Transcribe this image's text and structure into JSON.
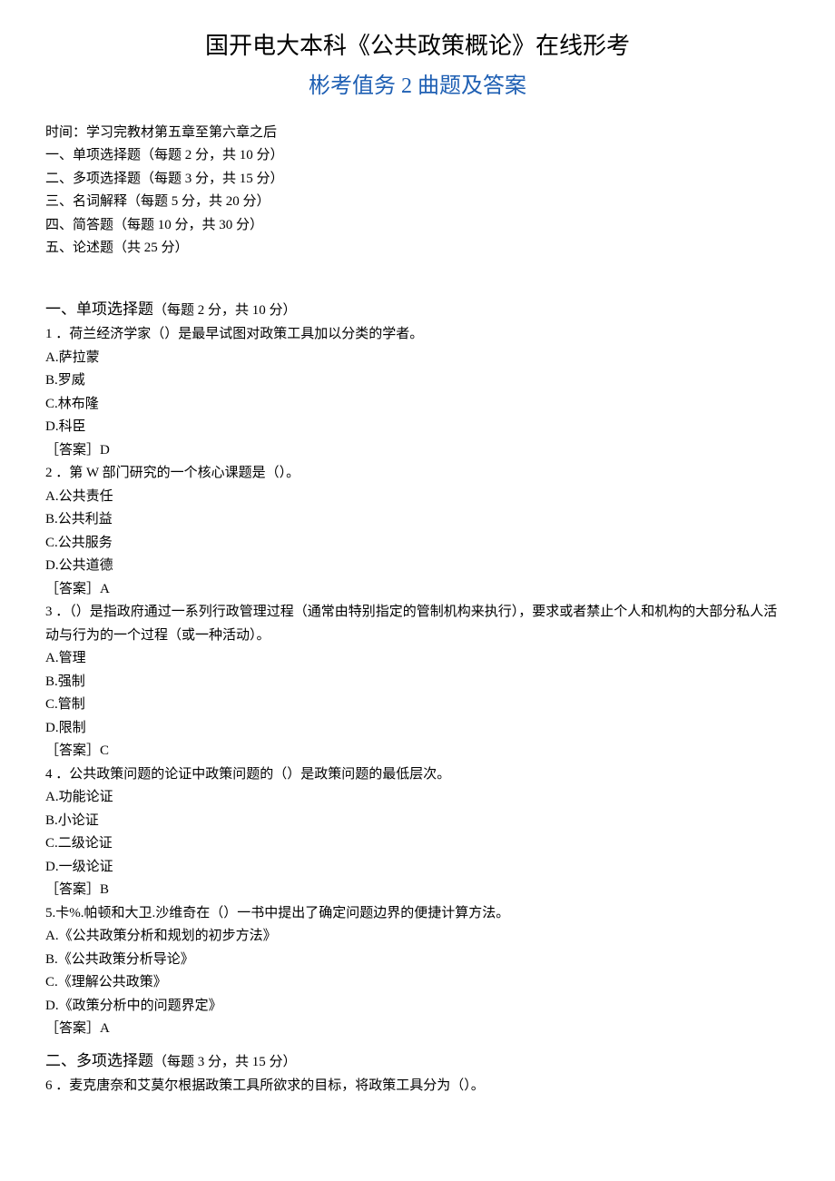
{
  "title": {
    "main": "国开电大本科《公共政策概论》在线形考",
    "sub": "彬考值务 2 曲题及答案"
  },
  "info": {
    "time": "时间：学习完教材第五章至第六章之后",
    "lines": [
      "一、单项选择题（每题 2 分，共 10 分）",
      "二、多项选择题（每题 3 分，共 15 分）",
      "三、名词解释（每题 5 分，共 20 分）",
      "四、简答题（每题 10 分，共 30 分）",
      "五、论述题（共 25 分）"
    ]
  },
  "section1": {
    "heading_prefix": "一、单项选择题",
    "heading_note": "（每题 2 分，共 10 分）",
    "q1": {
      "text": "1 ．荷兰经济学家（）是最早试图对政策工具加以分类的学者。",
      "a": "A.萨拉蒙",
      "b": "B.罗威",
      "c": "C.林布隆",
      "d": "D.科臣",
      "answer": "［答案］D"
    },
    "q2": {
      "text": "2 ．第 W 部门研究的一个核心课题是（）。",
      "a": "A.公共责任",
      "b": "B.公共利益",
      "c": "C.公共服务",
      "d": "D.公共道德",
      "answer": "［答案］A"
    },
    "q3": {
      "text": "3 ．（）是指政府通过一系列行政管理过程（通常由特别指定的管制机构来执行），要求或者禁止个人和机构的大部分私人活动与行为的一个过程（或一种活动）。",
      "a": "A.管理",
      "b": "B.强制",
      "c": "C.管制",
      "d": "D.限制",
      "answer": "［答案］C"
    },
    "q4": {
      "text": "4 ．公共政策问题的论证中政策问题的（）是政策问题的最低层次。",
      "a": "A.功能论证",
      "b": "B.小论证",
      "c": "C.二级论证",
      "d": "D.一级论证",
      "answer": "［答案］B"
    },
    "q5": {
      "text": "5.卡%.帕顿和大卫.沙维奇在（）一书中提出了确定问题边界的便捷计算方法。",
      "a": "A.《公共政策分析和规划的初步方法》",
      "b": "B.《公共政策分析导论》",
      "c": "C.《理解公共政策》",
      "d": "D.《政策分析中的问题界定》",
      "answer": "［答案］A"
    }
  },
  "section2": {
    "heading_prefix": "二、多项选择题",
    "heading_note": "（每题 3 分，共 15 分）",
    "q6": {
      "text": "6 ．麦克唐奈和艾莫尔根据政策工具所欲求的目标，将政策工具分为（）。"
    }
  }
}
